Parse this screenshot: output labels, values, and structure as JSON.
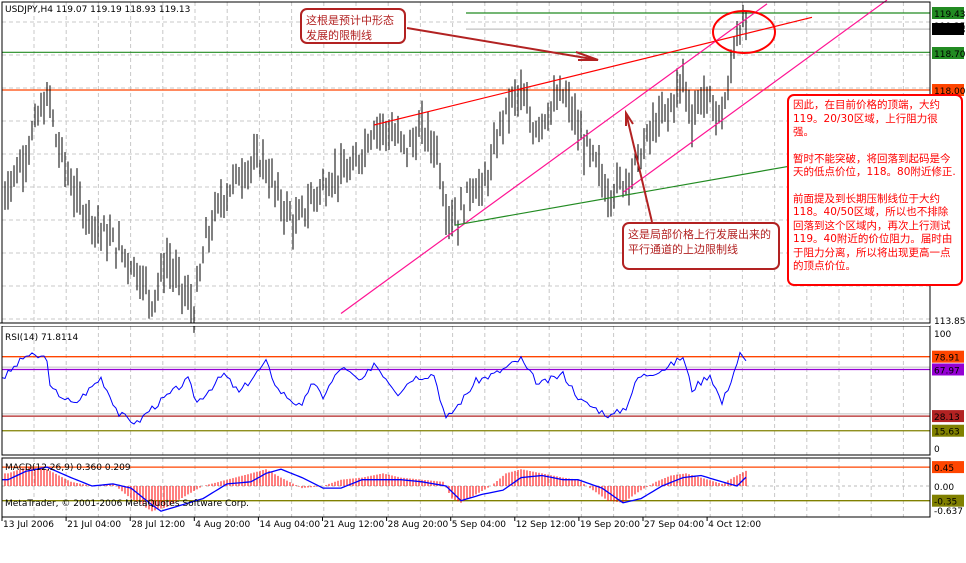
{
  "header": {
    "symbol_line": "USDJPY,H4  119.07 119.19 118.93 119.13"
  },
  "rsi_label": "RSI(14) 71.8114",
  "macd_label": "MACD(12,26,9) 0.360 0.209",
  "copyright": "MetaTrader, © 2001-2006 MetaQuotes Software Corp.",
  "notes": {
    "limit_line": "这根是预计中形态发展的限制线",
    "channel_line": "这是局部价格上行发展出来的平行通道的上边限制线",
    "analysis": [
      "因此，在目前价格的顶端，大约119。20/30区域，上行阻力很强。",
      "暂时不能突破，将回落到起码是今天的低点价位，118。80附近修正.",
      "前面提及到长期压制线位于大约118。40/50区域，所以也不排除回落到这个区域内，再次上行测试119。40附近的价位阻力。届时由于阻力分离，所以将出现更高一点的顶点价位。"
    ]
  },
  "colors": {
    "bars": "#000000",
    "rsi": "#0000ff",
    "macd_hist": "#ff0000",
    "signal": "#0000ff",
    "orange": "#ff4500",
    "green": "#228b22",
    "purple": "#9400d3",
    "brown": "#b22222",
    "olive": "#808000",
    "magenta": "#ff1493",
    "red": "#ff0000"
  },
  "chart_data": [
    {
      "type": "ohlc",
      "title": "USDJPY,H4",
      "ohlc_last": {
        "open": 119.07,
        "high": 119.19,
        "low": 118.93,
        "close": 119.13
      },
      "ylim": [
        113.85,
        119.5
      ],
      "price_labels": [
        {
          "value": "119.43",
          "style": "green"
        },
        {
          "value": "119.25",
          "style": "plain"
        },
        {
          "value": "119.13",
          "style": "black"
        },
        {
          "value": "118.70",
          "style": "green"
        },
        {
          "value": "118.00",
          "style": "orange"
        },
        {
          "value": "113.85",
          "style": "plain"
        }
      ],
      "hlines": [
        {
          "price": 119.43,
          "color": "green"
        },
        {
          "price": 119.13,
          "color": "gray"
        },
        {
          "price": 118.7,
          "color": "green"
        },
        {
          "price": 118.0,
          "color": "orange"
        }
      ],
      "x_tick_labels": [
        "13 Jul 2006",
        "21 Jul 04:00",
        "28 Jul 12:00",
        "4 Aug 20:00",
        "14 Aug 04:00",
        "21 Aug 12:00",
        "28 Aug 20:00",
        "5 Sep 04:00",
        "12 Sep 12:00",
        "19 Sep 20:00",
        "27 Sep 04:00",
        "4 Oct 12:00"
      ],
      "bar_count": 249,
      "close_anchors": {
        "bar": [
          1,
          7,
          13,
          16,
          18,
          25,
          33,
          40,
          45,
          50,
          55,
          60,
          64,
          68,
          73,
          80,
          87,
          92,
          98,
          103,
          110,
          117,
          124,
          130,
          135,
          140,
          145,
          148,
          152,
          157,
          160,
          163,
          167,
          170,
          173,
          177,
          182,
          187,
          190,
          193,
          198,
          202,
          207,
          212,
          217,
          222,
          227,
          230,
          233,
          237,
          239,
          242,
          244,
          246,
          248
        ],
        "price": [
          116.14,
          116.7,
          117.63,
          117.81,
          117.07,
          115.96,
          115.4,
          115.0,
          114.66,
          114.1,
          114.84,
          114.3,
          113.91,
          115.2,
          115.96,
          116.51,
          116.7,
          116.0,
          115.5,
          115.96,
          116.4,
          116.5,
          117.35,
          117.2,
          116.9,
          117.26,
          116.9,
          115.8,
          115.6,
          116.3,
          116.1,
          116.6,
          117.5,
          117.8,
          117.9,
          117.3,
          117.6,
          117.9,
          117.6,
          117.1,
          116.6,
          116.1,
          116.3,
          116.7,
          117.3,
          117.6,
          118.2,
          117.5,
          117.9,
          117.7,
          117.5,
          117.9,
          118.9,
          119.2,
          119.13
        ]
      },
      "trendlines": [
        {
          "name": "long-term limit line",
          "color": "red",
          "from": {
            "bar": 124,
            "price": 117.35
          },
          "to": {
            "bar": 270,
            "price": 119.35
          }
        },
        {
          "name": "channel lower",
          "color": "magenta",
          "from": {
            "bar": 113,
            "price": 113.85
          },
          "to": {
            "bar": 255,
            "price": 119.6
          }
        },
        {
          "name": "channel upper",
          "color": "magenta",
          "from": {
            "bar": 207,
            "price": 116.1
          },
          "to": {
            "bar": 295,
            "price": 119.67
          }
        },
        {
          "name": "support line",
          "color": "green",
          "from": {
            "bar": 151,
            "price": 115.49
          },
          "to": {
            "bar": 263,
            "price": 116.59
          }
        }
      ]
    },
    {
      "type": "line",
      "title": "RSI(14)",
      "value": 71.8114,
      "ylim": [
        0,
        100
      ],
      "tick_labels": [
        "100",
        "0"
      ],
      "levels": [
        {
          "value": "78.91",
          "color": "orange"
        },
        {
          "value": "67.97",
          "color": "purple"
        },
        {
          "value": "28.13",
          "color": "brown"
        },
        {
          "value": "15.63",
          "color": "olive"
        }
      ],
      "anchors": {
        "bar": [
          1,
          8,
          15,
          16,
          24,
          33,
          39,
          45,
          49,
          62,
          65,
          74,
          79,
          88,
          92,
          100,
          103,
          107,
          113,
          120,
          124,
          132,
          137,
          144,
          148,
          154,
          158,
          165,
          173,
          175,
          179,
          187,
          193,
          203,
          208,
          212,
          222,
          227,
          230,
          236,
          240,
          243,
          246,
          248
        ],
        "value": [
          62,
          80,
          78,
          52,
          38,
          61,
          30,
          22,
          33,
          59,
          40,
          64,
          48,
          74,
          51,
          35,
          57,
          45,
          70,
          57,
          74,
          48,
          61,
          64,
          25,
          44,
          58,
          65,
          77,
          68,
          55,
          64,
          41,
          28,
          36,
          61,
          70,
          79,
          51,
          64,
          39,
          59,
          81,
          74
        ]
      }
    },
    {
      "type": "bar+line",
      "title": "MACD(12,26,9)",
      "macd": 0.36,
      "signal": 0.209,
      "ylim": [
        -0.637,
        0.55
      ],
      "tick_labels": [
        "0.00",
        "-0.637"
      ],
      "levels": [
        {
          "value": "0.45",
          "color": "orange"
        },
        {
          "value": "-0.35",
          "color": "olive"
        }
      ],
      "hist_anchors": {
        "bar": [
          2,
          8,
          15,
          23,
          30,
          37,
          43,
          50,
          55,
          62,
          67,
          75,
          83,
          88,
          93,
          100,
          107,
          113,
          120,
          127,
          133,
          140,
          147,
          150,
          153,
          158,
          163,
          168,
          173,
          180,
          187,
          192,
          197,
          202,
          207,
          213,
          218,
          223,
          228,
          233,
          240,
          245,
          248
        ],
        "value": [
          0.3,
          0.45,
          0.4,
          0.1,
          0.0,
          0.05,
          -0.3,
          -0.6,
          -0.5,
          -0.2,
          0.0,
          0.15,
          0.3,
          0.4,
          0.2,
          -0.05,
          0.0,
          0.15,
          0.2,
          0.3,
          0.2,
          0.15,
          0.1,
          -0.3,
          -0.4,
          -0.2,
          0.0,
          0.3,
          0.4,
          0.3,
          0.2,
          0.15,
          -0.1,
          -0.35,
          -0.4,
          -0.1,
          0.1,
          0.25,
          0.3,
          0.2,
          0.05,
          0.25,
          0.36
        ]
      },
      "signal_anchors": {
        "bar": [
          2,
          8,
          15,
          23,
          30,
          37,
          43,
          50,
          53,
          60,
          67,
          75,
          83,
          88,
          93,
          100,
          107,
          113,
          120,
          127,
          133,
          140,
          148,
          153,
          160,
          167,
          173,
          180,
          187,
          192,
          200,
          207,
          213,
          220,
          227,
          233,
          240,
          245,
          248
        ],
        "value": [
          0.15,
          0.35,
          0.45,
          0.2,
          0.0,
          0.05,
          -0.05,
          -0.45,
          -0.6,
          -0.45,
          -0.3,
          0.05,
          0.1,
          0.3,
          0.4,
          0.2,
          -0.05,
          -0.05,
          0.15,
          0.15,
          0.15,
          0.1,
          0.0,
          -0.35,
          -0.2,
          -0.1,
          0.2,
          0.25,
          0.15,
          0.15,
          -0.05,
          -0.4,
          -0.3,
          0.0,
          0.2,
          0.25,
          0.1,
          0.0,
          0.21
        ]
      }
    }
  ]
}
